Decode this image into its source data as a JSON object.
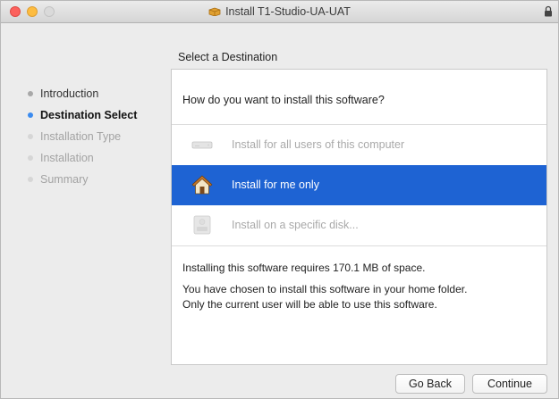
{
  "window": {
    "title": "Install T1-Studio-UA-UAT",
    "accent_color": "#1e63d3"
  },
  "header": {
    "step_title": "Select a Destination"
  },
  "sidebar": {
    "steps": [
      {
        "label": "Introduction",
        "state": "done"
      },
      {
        "label": "Destination Select",
        "state": "current"
      },
      {
        "label": "Installation Type",
        "state": "pending"
      },
      {
        "label": "Installation",
        "state": "pending"
      },
      {
        "label": "Summary",
        "state": "pending"
      }
    ]
  },
  "main": {
    "question": "How do you want to install this software?",
    "options": [
      {
        "label": "Install for all users of this computer",
        "icon": "drive-icon",
        "state": "disabled"
      },
      {
        "label": "Install for me only",
        "icon": "home-icon",
        "state": "selected"
      },
      {
        "label": "Install on a specific disk...",
        "icon": "disk-icon",
        "state": "disabled"
      }
    ],
    "space_required": "Installing this software requires 170.1 MB of space.",
    "description_line1": "You have chosen to install this software in your home folder.",
    "description_line2": "Only the current user will be able to use this software."
  },
  "footer": {
    "back_label": "Go Back",
    "continue_label": "Continue"
  }
}
